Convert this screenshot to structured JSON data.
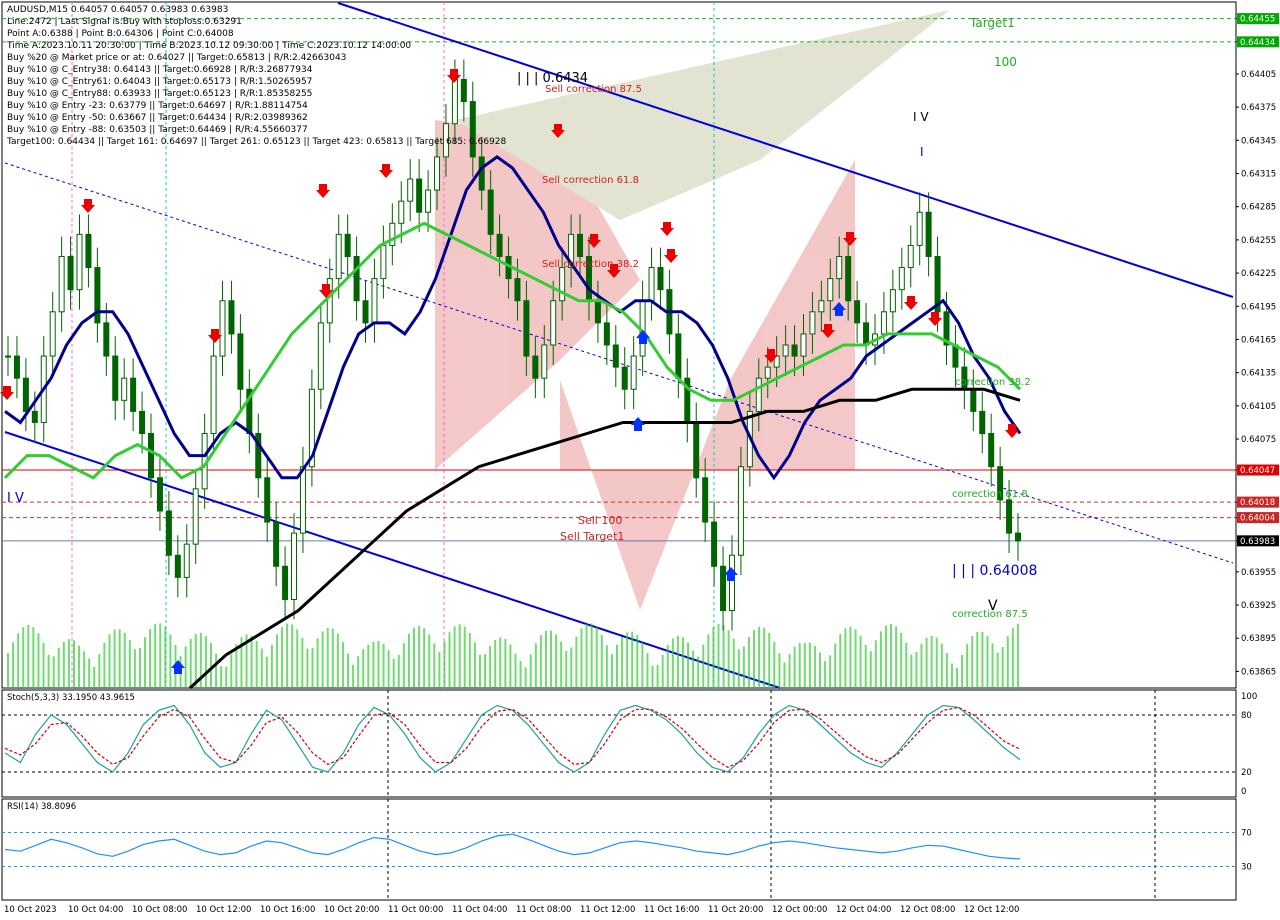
{
  "header": {
    "symbol": "AUDUSD,M15  0.64057 0.64057 0.63983 0.63983",
    "lines": [
      "Line:2472 | Last Signal is:Buy with stoploss:0.63291",
      "Point A:0.6388 | Point B:0.64306 | Point C:0.64008",
      "Time A:2023.10.11 20:30:00 | Time B:2023.10.12 09:30:00 | Time C:2023.10.12 14:00:00",
      "Buy %20 @ Market price or at: 0.64027 || Target:0.65813 | R/R:2.42663043",
      "Buy %10 @ C_Entry38: 0.64143 || Target:0.66928 | R/R:3.26877934",
      "Buy %10 @ C_Entry61: 0.64043 || Target:0.65173 | R/R:1.50265957",
      "Buy %10 @ C_Entry88: 0.63933 || Target:0.65123 | R/R:1.85358255",
      "Buy %10 @ Entry -23: 0.63779 || Target:0.64697 | R/R:1.88114754",
      "Buy %10 @ Entry -50: 0.63667 || Target:0.64434 | R/R:2.03989362",
      "Buy %10 @ Entry -88: 0.63503 || Target:0.64469 | R/R:4.55660377",
      "Target100: 0.64434 || Target 161: 0.64697 || Target 261: 0.65123 || Target 423: 0.65813 || Target 685: 0.66928"
    ]
  },
  "chart_data": {
    "type": "line",
    "symbol": "AUDUSD",
    "timeframe": "M15",
    "ylim": [
      0.6385,
      0.6447
    ],
    "x_ticks": [
      "10 Oct 2023",
      "10 Oct 04:00",
      "10 Oct 08:00",
      "10 Oct 12:00",
      "10 Oct 16:00",
      "10 Oct 20:00",
      "11 Oct 00:00",
      "11 Oct 04:00",
      "11 Oct 08:00",
      "11 Oct 12:00",
      "11 Oct 16:00",
      "11 Oct 20:00",
      "12 Oct 00:00",
      "12 Oct 04:00",
      "12 Oct 08:00",
      "12 Oct 12:00"
    ],
    "y_ticks": [
      "0.64455",
      "0.64434",
      "0.64405",
      "0.64375",
      "0.64345",
      "0.64315",
      "0.64285",
      "0.64255",
      "0.64225",
      "0.64195",
      "0.64165",
      "0.64135",
      "0.64105",
      "0.64075",
      "0.64047",
      "0.64018",
      "0.64004",
      "0.63983",
      "0.63955",
      "0.63925",
      "0.63895",
      "0.63865"
    ],
    "price_labels": [
      {
        "text": "0.64455",
        "value": 0.64455,
        "color": "#00aa00"
      },
      {
        "text": "0.64434",
        "value": 0.64434,
        "color": "#00aa00"
      },
      {
        "text": "0.64047",
        "value": 0.64047,
        "color": "#e00000"
      },
      {
        "text": "0.64018",
        "value": 0.64018,
        "color": "#cc2222"
      },
      {
        "text": "0.64004",
        "value": 0.64004,
        "color": "#cc2222"
      },
      {
        "text": "0.63983",
        "value": 0.63983,
        "color": "#000000"
      }
    ],
    "horizontal_lines": [
      {
        "value": 0.64455,
        "color": "#22aa22",
        "style": "dashed"
      },
      {
        "value": 0.64434,
        "color": "#22aa22",
        "style": "dashed"
      },
      {
        "value": 0.64047,
        "color": "#e00000",
        "style": "solid"
      },
      {
        "value": 0.64018,
        "color": "#cc3333",
        "style": "dashed"
      },
      {
        "value": 0.64004,
        "color": "#cc3333",
        "style": "dashed"
      },
      {
        "value": 0.63983,
        "color": "#6680a0",
        "style": "solid"
      }
    ],
    "annotations": [
      {
        "text": "Target1",
        "color": "#22aa22"
      },
      {
        "text": "100",
        "color": "#22aa22"
      },
      {
        "text": "| | | 0.6434",
        "color": "#000000"
      },
      {
        "text": "Sell correction 87.5",
        "color": "#cc2222"
      },
      {
        "text": "Sell correction 61.8",
        "color": "#cc2222"
      },
      {
        "text": "Sell correction 38.2",
        "color": "#cc2222"
      },
      {
        "text": "Sell 100",
        "color": "#cc2222"
      },
      {
        "text": "Sell Target1",
        "color": "#cc2222"
      },
      {
        "text": "I V",
        "color": "#000000"
      },
      {
        "text": "I",
        "color": "#0000cc"
      },
      {
        "text": "correction 38.2",
        "color": "#22aa22"
      },
      {
        "text": "correction 61.8",
        "color": "#22aa22"
      },
      {
        "text": "| | | 0.64008",
        "color": "#0000cc"
      },
      {
        "text": "V",
        "color": "#000000"
      },
      {
        "text": "correction 87.5",
        "color": "#22aa22"
      },
      {
        "text": "I V",
        "color": "#0000cc"
      }
    ],
    "close_series": [
      0.6415,
      0.6413,
      0.641,
      0.6409,
      0.6415,
      0.6419,
      0.6424,
      0.6421,
      0.6426,
      0.6423,
      0.6418,
      0.6415,
      0.6411,
      0.6413,
      0.641,
      0.6408,
      0.6404,
      0.6401,
      0.6397,
      0.6395,
      0.6398,
      0.6403,
      0.6408,
      0.6415,
      0.642,
      0.6417,
      0.6412,
      0.6408,
      0.6404,
      0.64,
      0.6396,
      0.6393,
      0.6399,
      0.6405,
      0.6412,
      0.6418,
      0.6422,
      0.6426,
      0.6424,
      0.642,
      0.6418,
      0.6422,
      0.6425,
      0.6427,
      0.6429,
      0.6431,
      0.6428,
      0.643,
      0.6433,
      0.6436,
      0.644,
      0.6438,
      0.6433,
      0.643,
      0.6426,
      0.6424,
      0.6422,
      0.642,
      0.6415,
      0.6413,
      0.6416,
      0.642,
      0.6423,
      0.6426,
      0.6424,
      0.642,
      0.6418,
      0.6416,
      0.6414,
      0.6412,
      0.6415,
      0.642,
      0.6423,
      0.6421,
      0.6417,
      0.6413,
      0.6409,
      0.6404,
      0.64,
      0.6396,
      0.6392,
      0.6397,
      0.6405,
      0.641,
      0.6413,
      0.6414,
      0.6415,
      0.6416,
      0.6415,
      0.6417,
      0.6419,
      0.642,
      0.6422,
      0.6424,
      0.642,
      0.6418,
      0.6416,
      0.6417,
      0.6419,
      0.6421,
      0.6423,
      0.6425,
      0.6428,
      0.6424,
      0.6419,
      0.6416,
      0.6414,
      0.6412,
      0.641,
      0.6408,
      0.6405,
      0.6402,
      0.6399,
      0.63983
    ],
    "ema_fast": [
      0.641,
      0.6409,
      0.6411,
      0.6413,
      0.6416,
      0.6418,
      0.6419,
      0.6419,
      0.6417,
      0.6414,
      0.6411,
      0.6408,
      0.6406,
      0.6406,
      0.6408,
      0.6409,
      0.6408,
      0.6406,
      0.6404,
      0.6404,
      0.6406,
      0.641,
      0.6414,
      0.6417,
      0.6418,
      0.6418,
      0.6417,
      0.6419,
      0.6422,
      0.6426,
      0.643,
      0.6432,
      0.6433,
      0.6432,
      0.643,
      0.6428,
      0.6425,
      0.6423,
      0.6421,
      0.642,
      0.6419,
      0.642,
      0.642,
      0.6419,
      0.6419,
      0.6418,
      0.6416,
      0.6413,
      0.6409,
      0.6406,
      0.6404,
      0.6406,
      0.6409,
      0.6411,
      0.6412,
      0.6413,
      0.6415,
      0.6416,
      0.6417,
      0.6418,
      0.6419,
      0.642,
      0.6418,
      0.6415,
      0.6413,
      0.641,
      0.6408
    ],
    "sma_mid": [
      0.6404,
      0.6406,
      0.6406,
      0.6405,
      0.6404,
      0.6406,
      0.6407,
      0.6406,
      0.6404,
      0.6405,
      0.6408,
      0.6411,
      0.6414,
      0.6417,
      0.6419,
      0.6421,
      0.6423,
      0.6425,
      0.6426,
      0.6427,
      0.6426,
      0.6425,
      0.6424,
      0.6423,
      0.6422,
      0.6421,
      0.642,
      0.642,
      0.6419,
      0.6417,
      0.6414,
      0.6412,
      0.6411,
      0.6411,
      0.6412,
      0.6413,
      0.6414,
      0.6415,
      0.6416,
      0.6416,
      0.6417,
      0.6417,
      0.6417,
      0.6416,
      0.6415,
      0.6414,
      0.6412
    ],
    "sma_slow": [
      0.6385,
      0.6388,
      0.639,
      0.6392,
      0.6395,
      0.6398,
      0.6401,
      0.6403,
      0.6405,
      0.6406,
      0.6407,
      0.6408,
      0.6409,
      0.6409,
      0.6409,
      0.6409,
      0.641,
      0.641,
      0.6411,
      0.6411,
      0.6412,
      0.6412,
      0.6412,
      0.6411
    ],
    "stoch_title": "Stoch(5,3,3) 33.1950 43.9615",
    "stoch_levels": [
      100,
      80,
      20,
      0
    ],
    "stoch_k": [
      40,
      30,
      60,
      80,
      70,
      50,
      30,
      20,
      40,
      70,
      85,
      90,
      70,
      40,
      25,
      30,
      60,
      85,
      75,
      50,
      25,
      20,
      40,
      70,
      88,
      80,
      60,
      35,
      20,
      30,
      55,
      80,
      90,
      85,
      70,
      50,
      30,
      20,
      30,
      60,
      85,
      90,
      85,
      75,
      60,
      40,
      25,
      20,
      35,
      60,
      80,
      90,
      85,
      70,
      55,
      40,
      30,
      25,
      40,
      60,
      80,
      90,
      88,
      75,
      60,
      45,
      33
    ],
    "stoch_d": [
      45,
      38,
      50,
      70,
      72,
      58,
      40,
      28,
      35,
      58,
      78,
      86,
      78,
      55,
      35,
      30,
      48,
      72,
      78,
      62,
      40,
      28,
      35,
      58,
      80,
      82,
      70,
      48,
      30,
      30,
      45,
      68,
      84,
      86,
      76,
      58,
      40,
      28,
      30,
      50,
      75,
      86,
      86,
      78,
      66,
      50,
      35,
      25,
      32,
      50,
      72,
      85,
      86,
      76,
      62,
      48,
      36,
      30,
      38,
      55,
      72,
      85,
      88,
      80,
      66,
      52,
      44
    ],
    "rsi_title": "RSI(14) 38.8096",
    "rsi_levels": [
      70,
      30
    ],
    "rsi_values": [
      50,
      48,
      55,
      62,
      58,
      52,
      45,
      42,
      48,
      56,
      60,
      62,
      55,
      48,
      44,
      46,
      54,
      60,
      58,
      52,
      46,
      44,
      50,
      58,
      64,
      62,
      55,
      48,
      44,
      46,
      52,
      60,
      66,
      68,
      62,
      55,
      48,
      44,
      46,
      52,
      58,
      60,
      58,
      55,
      52,
      48,
      46,
      44,
      48,
      54,
      58,
      60,
      58,
      55,
      52,
      50,
      48,
      46,
      48,
      52,
      55,
      54,
      50,
      46,
      42,
      40,
      39
    ],
    "panel_levels_right": [
      "100",
      "80",
      "20",
      "0",
      "70",
      "30",
      "0"
    ]
  },
  "colors": {
    "background": "#ffffff",
    "plot_bg": "#ffffff",
    "channel": "#0000dd",
    "ema_fast": "#00008b",
    "sma_mid": "#33cc33",
    "sma_slow": "#000000",
    "candle": "#006400",
    "volume": "#33cc33",
    "stoch_k": "#20a0a0",
    "stoch_d": "#cc0000",
    "rsi": "#1e90ff",
    "sell_arrow": "#ee0000",
    "buy_arrow": "#0033ff"
  }
}
